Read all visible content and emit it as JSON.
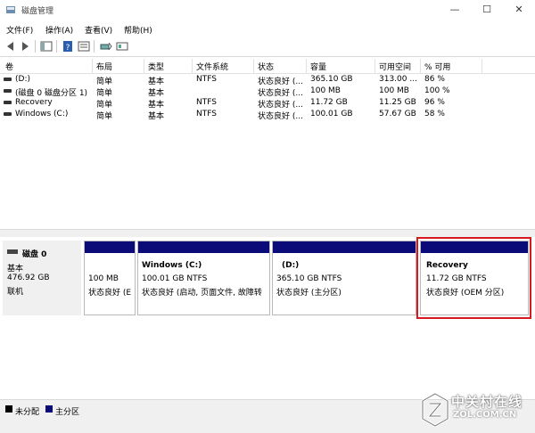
{
  "window": {
    "title": "磁盘管理",
    "minimize": "—",
    "maximize": "☐",
    "close": "✕"
  },
  "menu": [
    "文件(F)",
    "操作(A)",
    "查看(V)",
    "帮助(H)"
  ],
  "toolbar": [
    "back-icon",
    "forward-icon",
    "show-hide-console-icon",
    "help-icon",
    "properties-icon",
    "disk-settings-icon",
    "refresh-icon"
  ],
  "table": {
    "headers": [
      "卷",
      "布局",
      "类型",
      "文件系统",
      "状态",
      "容量",
      "可用空间",
      "% 可用"
    ],
    "rows": [
      [
        "(D:)",
        "简单",
        "基本",
        "NTFS",
        "状态良好 (...",
        "365.10 GB",
        "313.00 ...",
        "86 %"
      ],
      [
        "(磁盘 0 磁盘分区 1)",
        "简单",
        "基本",
        "",
        "状态良好 (...",
        "100 MB",
        "100 MB",
        "100 %"
      ],
      [
        "Recovery",
        "简单",
        "基本",
        "NTFS",
        "状态良好 (...",
        "11.72 GB",
        "11.25 GB",
        "96 %"
      ],
      [
        "Windows (C:)",
        "简单",
        "基本",
        "NTFS",
        "状态良好 (...",
        "100.01 GB",
        "57.67 GB",
        "58 %"
      ]
    ]
  },
  "disk": {
    "name": "磁盘 0",
    "type": "基本",
    "size": "476.92 GB",
    "status": "联机"
  },
  "partitions": [
    {
      "title": "",
      "size": "100 MB",
      "status": "状态良好 (E"
    },
    {
      "title": "Windows  (C:)",
      "size": "100.01 GB NTFS",
      "status": "状态良好 (启动, 页面文件, 故障转"
    },
    {
      "title": "(D:)",
      "size": "365.10 GB NTFS",
      "status": "状态良好 (主分区)"
    },
    {
      "title": "Recovery",
      "size": "11.72 GB NTFS",
      "status": "状态良好 (OEM 分区)"
    }
  ],
  "legend": {
    "unallocated": "未分配",
    "primary": "主分区"
  },
  "colors": {
    "primary_partition": "#0a0a78",
    "highlight": "#d71920"
  },
  "watermark": {
    "cn": "中关村在线",
    "en": "ZOL.COM.CN"
  }
}
